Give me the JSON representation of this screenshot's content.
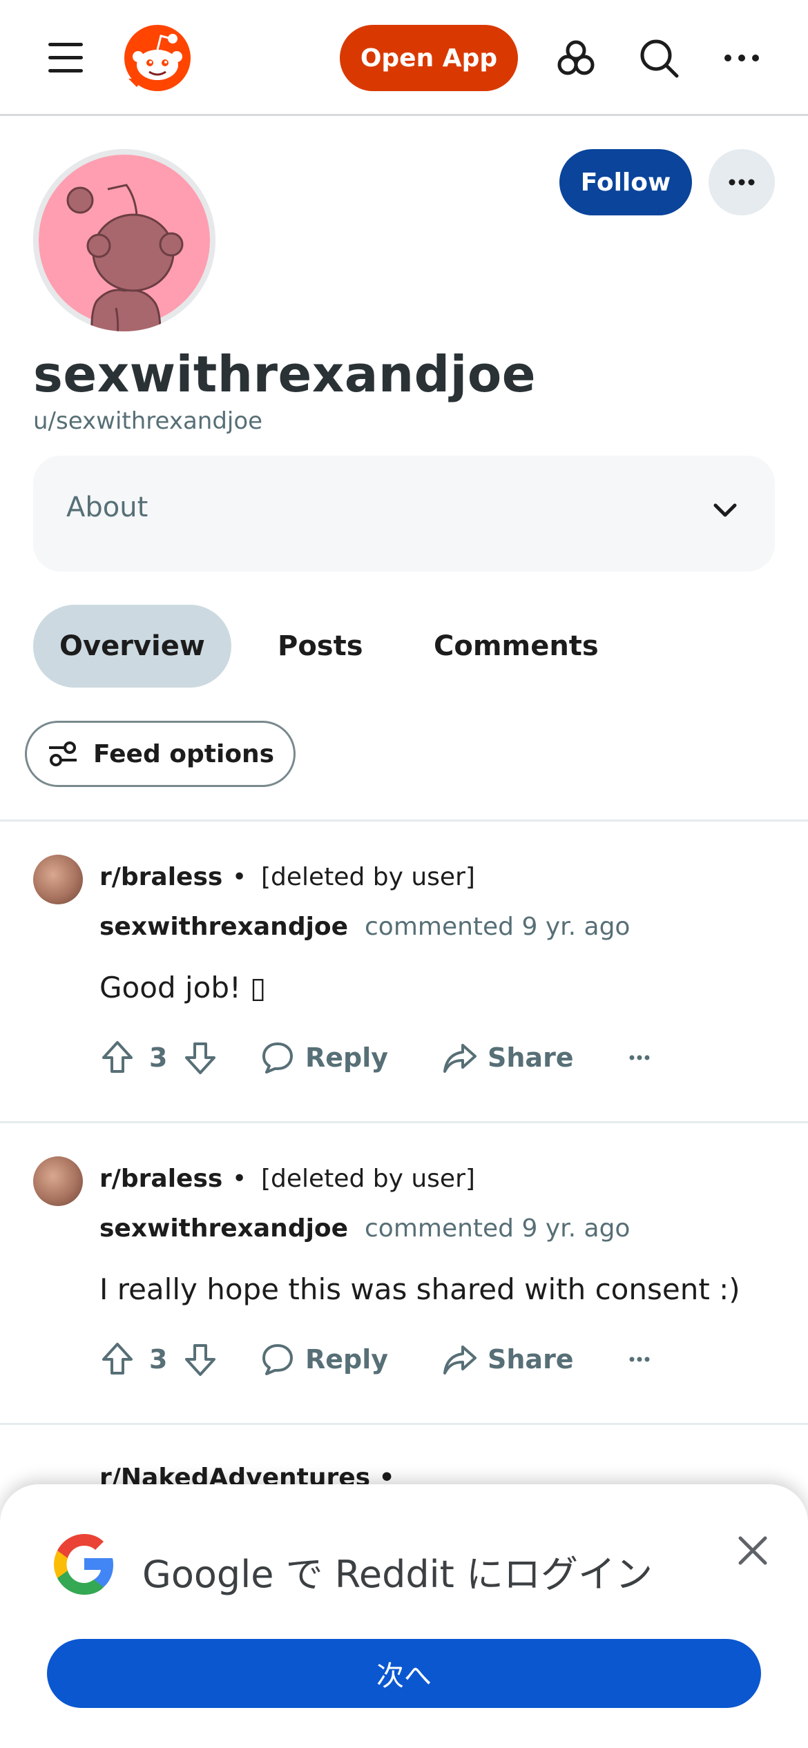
{
  "header": {
    "menu_icon": "hamburger-menu-icon",
    "logo_icon": "reddit-logo-icon",
    "open_app_label": "Open App",
    "icons": [
      "communities-icon",
      "search-icon",
      "more-icon"
    ]
  },
  "profile": {
    "display_name": "sexwithrexandjoe",
    "username": "u/sexwithrexandjoe",
    "follow_label": "Follow",
    "avatar_icon": "snoo-avatar-icon",
    "about_label": "About"
  },
  "tabs": [
    {
      "label": "Overview",
      "active": true
    },
    {
      "label": "Posts",
      "active": false
    },
    {
      "label": "Comments",
      "active": false
    }
  ],
  "feed_options_label": "Feed options",
  "comments": [
    {
      "subreddit": "r/braless",
      "post_title": "[deleted by user]",
      "author": "sexwithrexandjoe",
      "meta": "commented 9 yr. ago",
      "body": "Good job! ▯",
      "score": "3",
      "reply_label": "Reply",
      "share_label": "Share"
    },
    {
      "subreddit": "r/braless",
      "post_title": "[deleted by user]",
      "author": "sexwithrexandjoe",
      "meta": "commented 9 yr. ago",
      "body": "I really hope this was shared with consent :)",
      "score": "3",
      "reply_label": "Reply",
      "share_label": "Share"
    }
  ],
  "third_subreddit": "r/NakedAdventures •",
  "login_sheet": {
    "title": "Google で Reddit にログイン",
    "button_label": "次へ",
    "google_icon": "google-logo-icon"
  },
  "colors": {
    "open_app": "#d93900",
    "follow": "#0a449b",
    "tab_active": "#ccd9e0",
    "google_button": "#0b57d0",
    "avatar_bg": "#ff9eb0"
  }
}
